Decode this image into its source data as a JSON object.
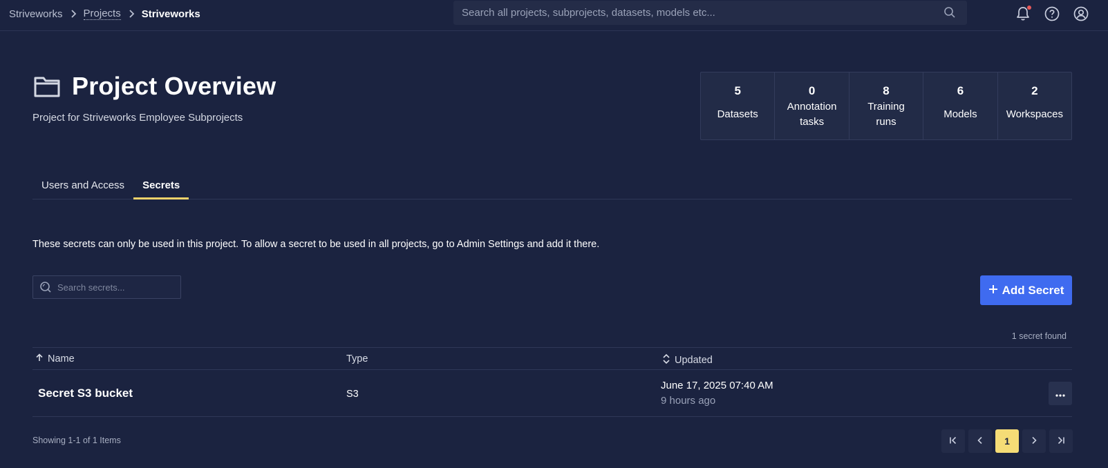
{
  "topbar": {
    "breadcrumb": [
      "Striveworks",
      "Projects",
      "Striveworks"
    ],
    "search_placeholder": "Search all projects, subprojects, datasets, models etc..."
  },
  "header": {
    "title": "Project Overview",
    "subtitle": "Project for Striveworks Employee Subprojects"
  },
  "stats": [
    {
      "value": "5",
      "label": "Datasets"
    },
    {
      "value": "0",
      "label": "Annotation tasks"
    },
    {
      "value": "8",
      "label": "Training runs"
    },
    {
      "value": "6",
      "label": "Models"
    },
    {
      "value": "2",
      "label": "Workspaces"
    }
  ],
  "tabs": [
    {
      "label": "Users and Access",
      "active": false
    },
    {
      "label": "Secrets",
      "active": true
    }
  ],
  "secrets": {
    "info": "These secrets can only be used in this project. To allow a secret to be used in all projects, go to Admin Settings and add it there.",
    "search_placeholder": "Search secrets...",
    "add_label": "Add Secret",
    "count_text": "1 secret found",
    "columns": [
      "Name",
      "Type",
      "Updated"
    ],
    "rows": [
      {
        "name": "Secret S3 bucket",
        "type": "S3",
        "updated": "June 17, 2025 07:40 AM",
        "updated_relative": "9 hours ago"
      }
    ],
    "showing_text": "Showing 1-1 of 1 Items",
    "current_page": "1"
  },
  "colors": {
    "background": "#1b2340",
    "accent": "#3f6bf0",
    "tab_underline": "#f3d36b",
    "page_active": "#f5dc76",
    "notification": "#e85a5a"
  }
}
